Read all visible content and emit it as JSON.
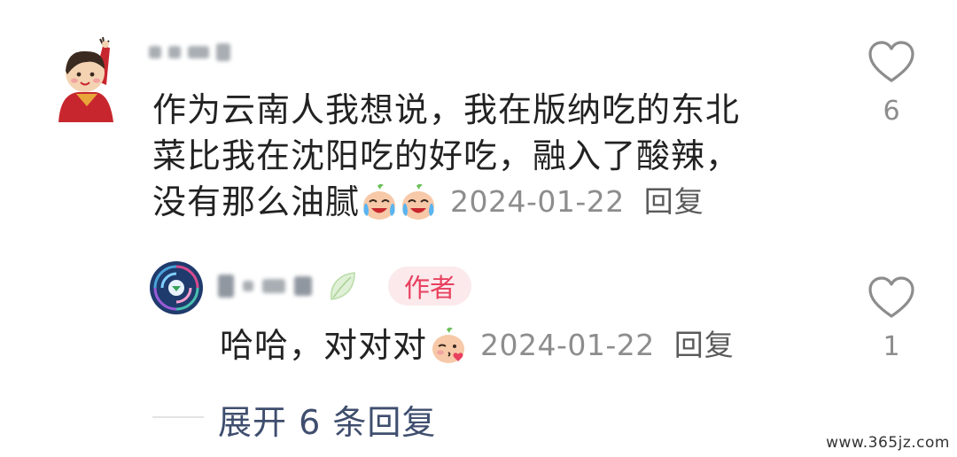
{
  "comment": {
    "avatar_icon": "cartoon-waving-avatar",
    "text_line_1": "作为云南人我想说，我在版纳吃的东北",
    "text_line_2": "菜比我在沈阳吃的好吃，融入了酸辣，",
    "text_line_3": "没有那么油腻",
    "emojis": [
      "crying-laugh-emoji",
      "crying-laugh-emoji"
    ],
    "date": "2024-01-22",
    "reply_label": "回复",
    "like_icon": "heart-outline-icon",
    "like_count": "6"
  },
  "reply": {
    "avatar_icon": "blue-swirl-avatar",
    "name_suffix_icon": "leaf-icon",
    "author_badge": "作者",
    "text": "哈哈，对对对",
    "emoji": "blush-kiss-emoji",
    "date": "2024-01-22",
    "reply_label": "回复",
    "like_icon": "heart-outline-icon",
    "like_count": "1"
  },
  "expand": {
    "label": "展开 6 条回复"
  },
  "watermark": {
    "text": "www.365jz.com"
  },
  "colors": {
    "author_badge_bg": "#fbe9ec",
    "author_badge_text": "#e8405e",
    "expand_link": "#3f4e6e",
    "meta_gray": "#8d8d8d"
  }
}
